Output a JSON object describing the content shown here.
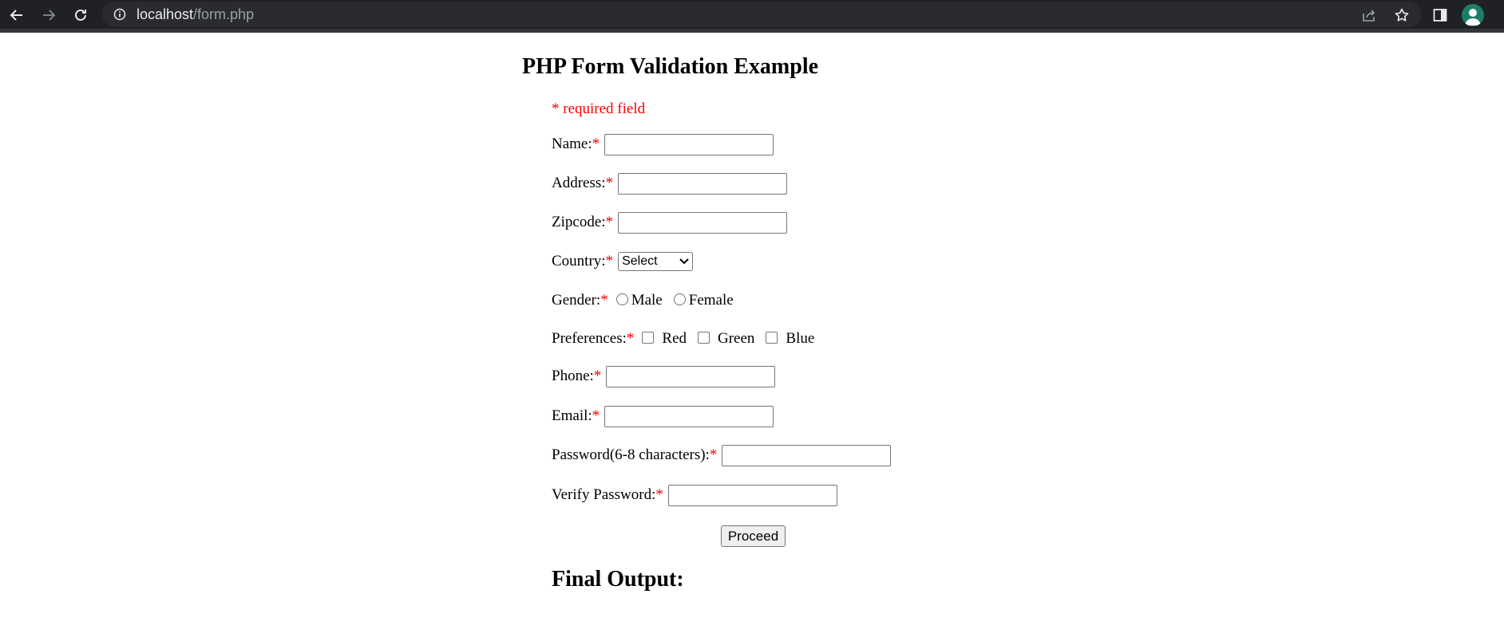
{
  "browser": {
    "url_host": "localhost",
    "url_path": "/form.php",
    "icons": {
      "back": "arrow-left-icon",
      "forward": "arrow-right-icon",
      "reload": "reload-icon",
      "site_info": "info-icon",
      "share": "share-icon",
      "bookmark": "star-icon",
      "side_panel": "side-panel-icon",
      "profile": "avatar-icon"
    }
  },
  "page": {
    "title": "PHP Form Validation Example",
    "required_note": "* required field",
    "required_star": "*",
    "fields": {
      "name": {
        "label": "Name:",
        "value": ""
      },
      "address": {
        "label": "Address:",
        "value": ""
      },
      "zipcode": {
        "label": "Zipcode:",
        "value": ""
      },
      "country": {
        "label": "Country:",
        "selected": "Select"
      },
      "gender": {
        "label": "Gender:",
        "options": [
          "Male",
          "Female"
        ]
      },
      "preferences": {
        "label": "Preferences:",
        "options": [
          "Red",
          "Green",
          "Blue"
        ]
      },
      "phone": {
        "label": "Phone:",
        "value": ""
      },
      "email": {
        "label": "Email:",
        "value": ""
      },
      "password": {
        "label": "Password(6-8 characters):",
        "value": ""
      },
      "verify_password": {
        "label": "Verify Password:",
        "value": ""
      }
    },
    "submit_label": "Proceed",
    "output_heading": "Final Output:"
  },
  "colors": {
    "chrome_bg": "#202124",
    "omnibox_bg": "#2a2b2e",
    "required": "#ff0000",
    "avatar_bg": "#1b7e68"
  }
}
